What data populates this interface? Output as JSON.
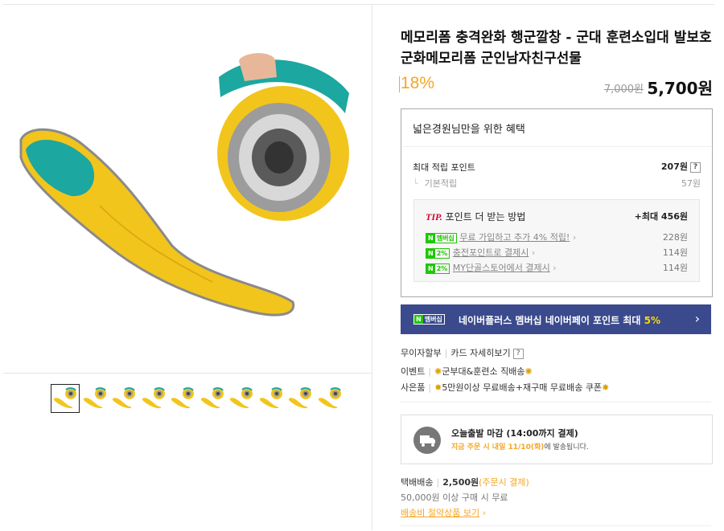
{
  "product": {
    "title": "메모리폼 충격완화 행군깔창 - 군대 훈련소입대 발보호 군화메모리폼 군인남자친구선물",
    "discount": "18%",
    "original_price": "7,000원",
    "sale_price": "5,700원"
  },
  "benefit": {
    "title": "넓은경원님만을 위한 혜택",
    "max_points_label": "최대 적립 포인트",
    "max_points_value": "207원",
    "basic_label": "기본적립",
    "basic_value": "57원",
    "tip_label": "TIP.",
    "tip_title": "포인트 더 받는 방법",
    "tip_max": "+최대 456원",
    "tips": [
      {
        "badge_text": "멤버십",
        "label": "무료 가입하고 추가 4% 적립!",
        "value": "228원"
      },
      {
        "badge_text": "2%",
        "label": "충전포인트로 결제시",
        "value": "114원"
      },
      {
        "badge_text": "2%",
        "label": "MY단골스토어에서 결제시",
        "value": "114원"
      }
    ]
  },
  "promo": {
    "badge_text": "멤버십",
    "text": "네이버플러스 멤버십 네이버페이 포인트 최대",
    "highlight": "5%"
  },
  "info": {
    "installment": "무이자할부",
    "card_detail": "카드 자세히보기",
    "event_label": "이벤트",
    "event_text": "군부대&훈련소 직배송",
    "gift_label": "사은품",
    "gift_text": "5만원이상 무료배송+재구매 무료배송 쿠폰"
  },
  "shipping_box": {
    "title": "오늘출발 마감 (14:00까지 결제)",
    "highlight": "지금 주문 시 내일 11/10(화)",
    "suffix": "에 발송됩니다."
  },
  "delivery": {
    "method": "택배배송",
    "fee": "2,500원",
    "pay_note": "(주문시 결제)",
    "free_note": "50,000원 이상 구매 시 무료",
    "save_link": "배송비 절약상품 보기"
  },
  "thumbnail_count": 10,
  "colors": {
    "accent_orange": "#f5a623",
    "naver_green": "#1ec800",
    "promo_bg": "#3a4a8c",
    "tip_red": "#d6002f"
  }
}
